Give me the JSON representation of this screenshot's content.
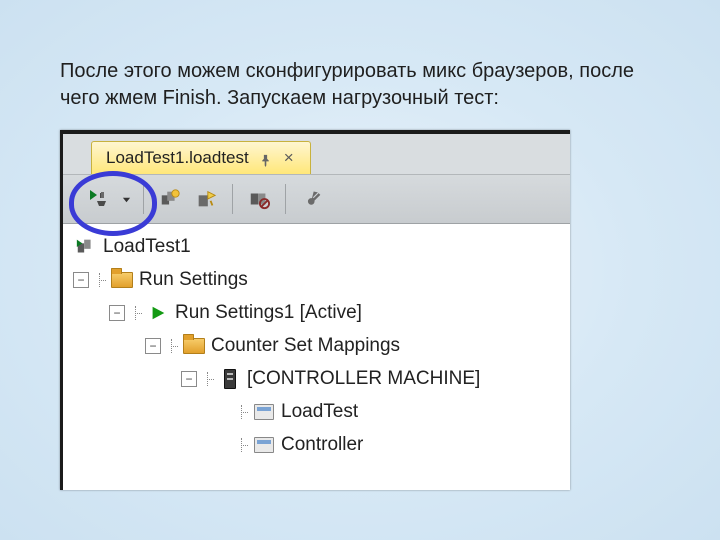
{
  "caption": "После этого можем сконфигурировать микс браузеров, после чего жмем Finish. Запускаем нагрузочный тест:",
  "tab": {
    "title": "LoadTest1.loadtest"
  },
  "toolbar": {
    "run": "run-load-test",
    "edit_mix": "edit-test-mix",
    "new_scenario": "add-scenario",
    "manage_counters": "manage-counter-sets",
    "settings": "settings"
  },
  "tree": {
    "root": "LoadTest1",
    "run_settings": "Run Settings",
    "active": "Run Settings1 [Active]",
    "counter_mappings": "Counter Set Mappings",
    "controller": "[CONTROLLER MACHINE]",
    "items": {
      "loadtest": "LoadTest",
      "controller_item": "Controller"
    }
  }
}
